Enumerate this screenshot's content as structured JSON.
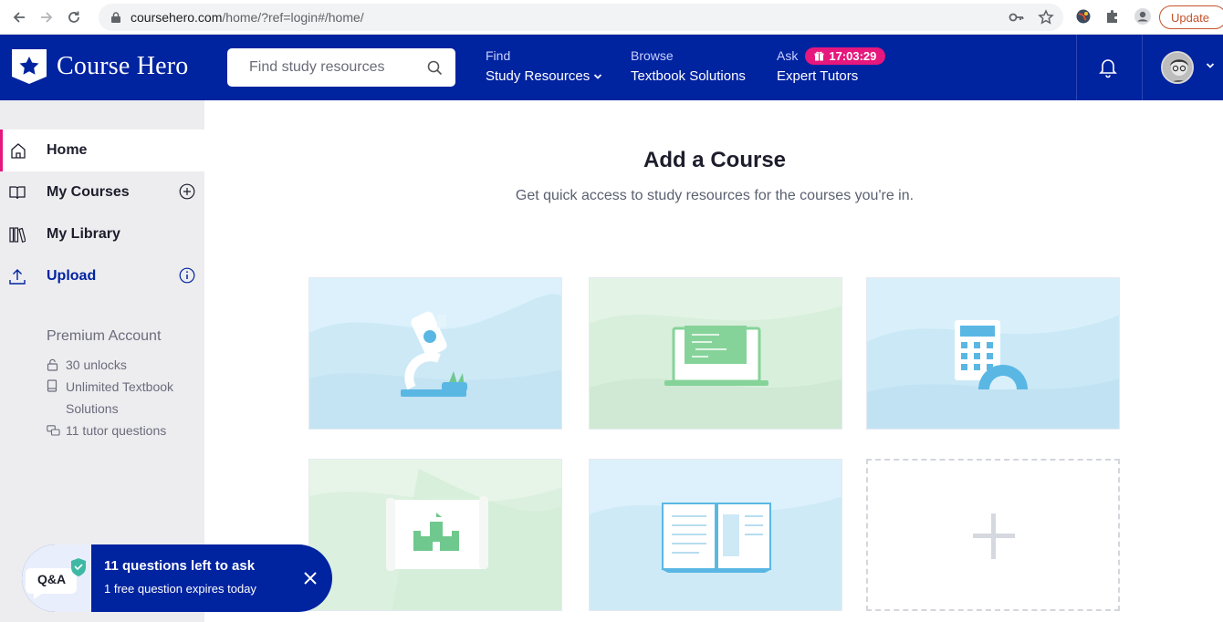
{
  "browser": {
    "url_host": "coursehero.com",
    "url_path": "/home/?ref=login#/home/",
    "update_label": "Update"
  },
  "header": {
    "logo_text": "Course Hero",
    "search_placeholder": "Find study resources",
    "nav": [
      {
        "small": "Find",
        "big": "Study Resources"
      },
      {
        "small": "Browse",
        "big": "Textbook Solutions"
      },
      {
        "small": "Ask",
        "big": "Expert Tutors",
        "timer": "17:03:29"
      }
    ]
  },
  "sidebar": {
    "items": [
      {
        "label": "Home"
      },
      {
        "label": "My Courses"
      },
      {
        "label": "My Library"
      },
      {
        "label": "Upload"
      }
    ],
    "premium_title": "Premium Account",
    "perks": [
      "30 unlocks",
      "Unlimited Textbook",
      "Solutions",
      "11 tutor questions"
    ]
  },
  "main": {
    "title": "Add a Course",
    "subtitle": "Get quick access to study resources for the courses you're in."
  },
  "toast": {
    "badge": "Q&A",
    "title": "11 questions left to ask",
    "subtitle": "1 free question expires today"
  },
  "colors": {
    "brand_blue": "#0023a0",
    "accent_pink": "#e6177d"
  }
}
